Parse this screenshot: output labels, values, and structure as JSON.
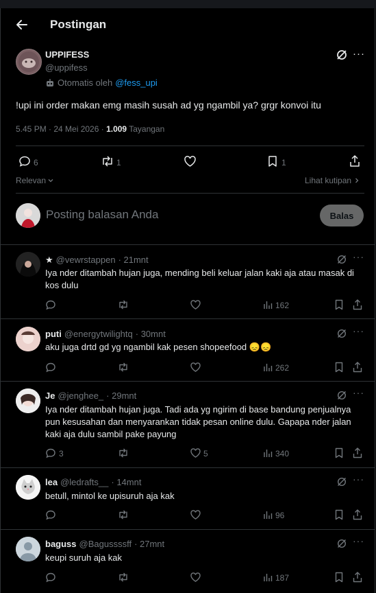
{
  "header": {
    "title": "Postingan"
  },
  "post": {
    "display_name": "UPPIFESS",
    "handle": "@uppifess",
    "automated_label": "Otomatis oleh",
    "automated_by": "@fess_upi",
    "text": "!upi ini order makan emg masih susah ad yg ngambil ya? grgr konvoi itu",
    "time": "5.45 PM · 24 Mei 2026 ·",
    "views_count": "1.009",
    "views_label": "Tayangan",
    "replies": "6",
    "reposts": "1",
    "bookmarks": "1"
  },
  "filters": {
    "sort_label": "Relevan",
    "quotes_label": "Lihat kutipan"
  },
  "composer": {
    "placeholder": "Posting balasan Anda",
    "reply_button": "Balas"
  },
  "replies": [
    {
      "name": "",
      "verified_star": "★",
      "handle": "@vewrstappen",
      "time": "· 21mnt",
      "text": "Iya nder ditambah hujan juga, mending beli keluar jalan kaki aja atau masak di kos dulu",
      "reply_count": "",
      "like_count": "",
      "views": "162"
    },
    {
      "name": "puti",
      "handle": "@energytwilightq",
      "time": "· 30mnt",
      "text": "aku juga drtd gd yg ngambil kak pesen shopeefood 😞😞",
      "reply_count": "",
      "like_count": "",
      "views": "262"
    },
    {
      "name": "Je",
      "handle": "@jenghee_",
      "time": "· 29mnt",
      "text": "Iya nder ditambah hujan juga. Tadi ada yg ngirim di base bandung penjualnya pun kesusahan dan menyarankan tidak pesan online dulu. Gapapa nder jalan kaki aja dulu sambil pake payung",
      "reply_count": "3",
      "like_count": "5",
      "views": "340"
    },
    {
      "name": "lea",
      "handle": "@ledrafts__",
      "time": "· 14mnt",
      "text": "betull, mintol ke upisuruh aja kak",
      "reply_count": "",
      "like_count": "",
      "views": "96"
    },
    {
      "name": "baguss",
      "handle": "@Bagussssff",
      "time": "· 27mnt",
      "text": "keupi suruh aja kak",
      "reply_count": "",
      "like_count": "",
      "views": "187"
    }
  ]
}
